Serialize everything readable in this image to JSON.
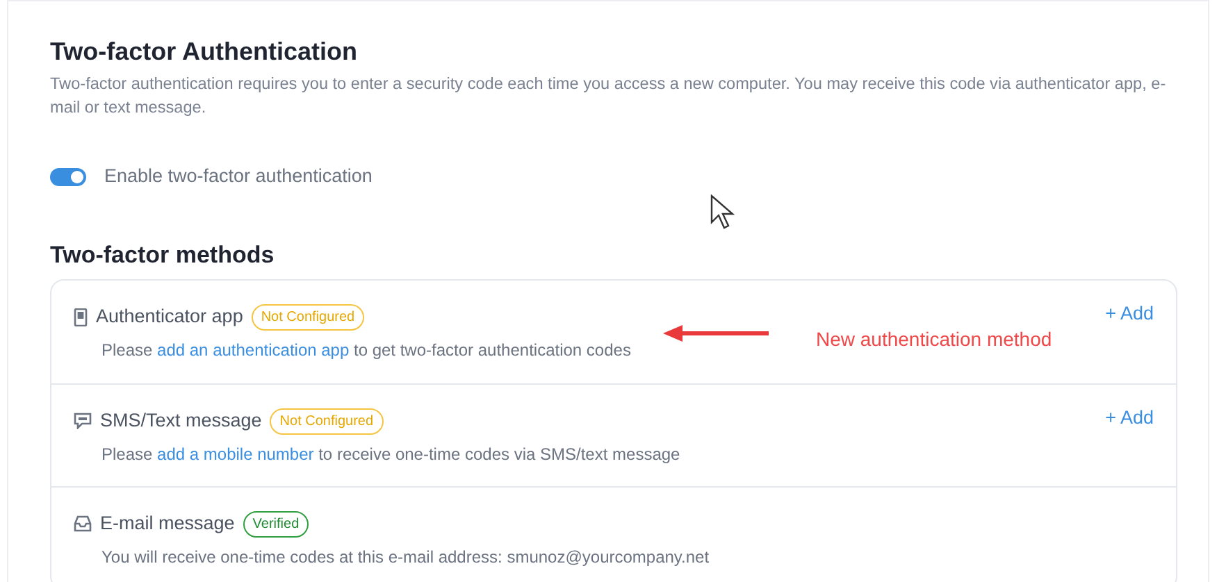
{
  "section": {
    "title": "Two-factor Authentication",
    "description": "Two-factor authentication requires you to enter a security code each time you access a new computer. You may receive this code via authenticator app, e-mail or text message."
  },
  "toggle": {
    "label": "Enable two-factor authentication",
    "on": true
  },
  "methods_title": "Two-factor methods",
  "methods": [
    {
      "kind": "app",
      "title": "Authenticator app",
      "status": {
        "kind": "not_configured",
        "label": "Not Configured"
      },
      "before": "Please ",
      "link": "add an authentication app",
      "after": " to get two-factor authentication codes",
      "add": "+ Add"
    },
    {
      "kind": "sms",
      "title": "SMS/Text message",
      "status": {
        "kind": "not_configured",
        "label": "Not Configured"
      },
      "before": "Please ",
      "link": "add a mobile number",
      "after": " to receive one-time codes via SMS/text message",
      "add": "+ Add"
    },
    {
      "kind": "email",
      "title": "E-mail message",
      "status": {
        "kind": "verified",
        "label": "Verified"
      },
      "before": "You will receive one-time codes at this e-mail address: smunoz@yourcompany.net"
    }
  ],
  "annotation": "New authentication method"
}
